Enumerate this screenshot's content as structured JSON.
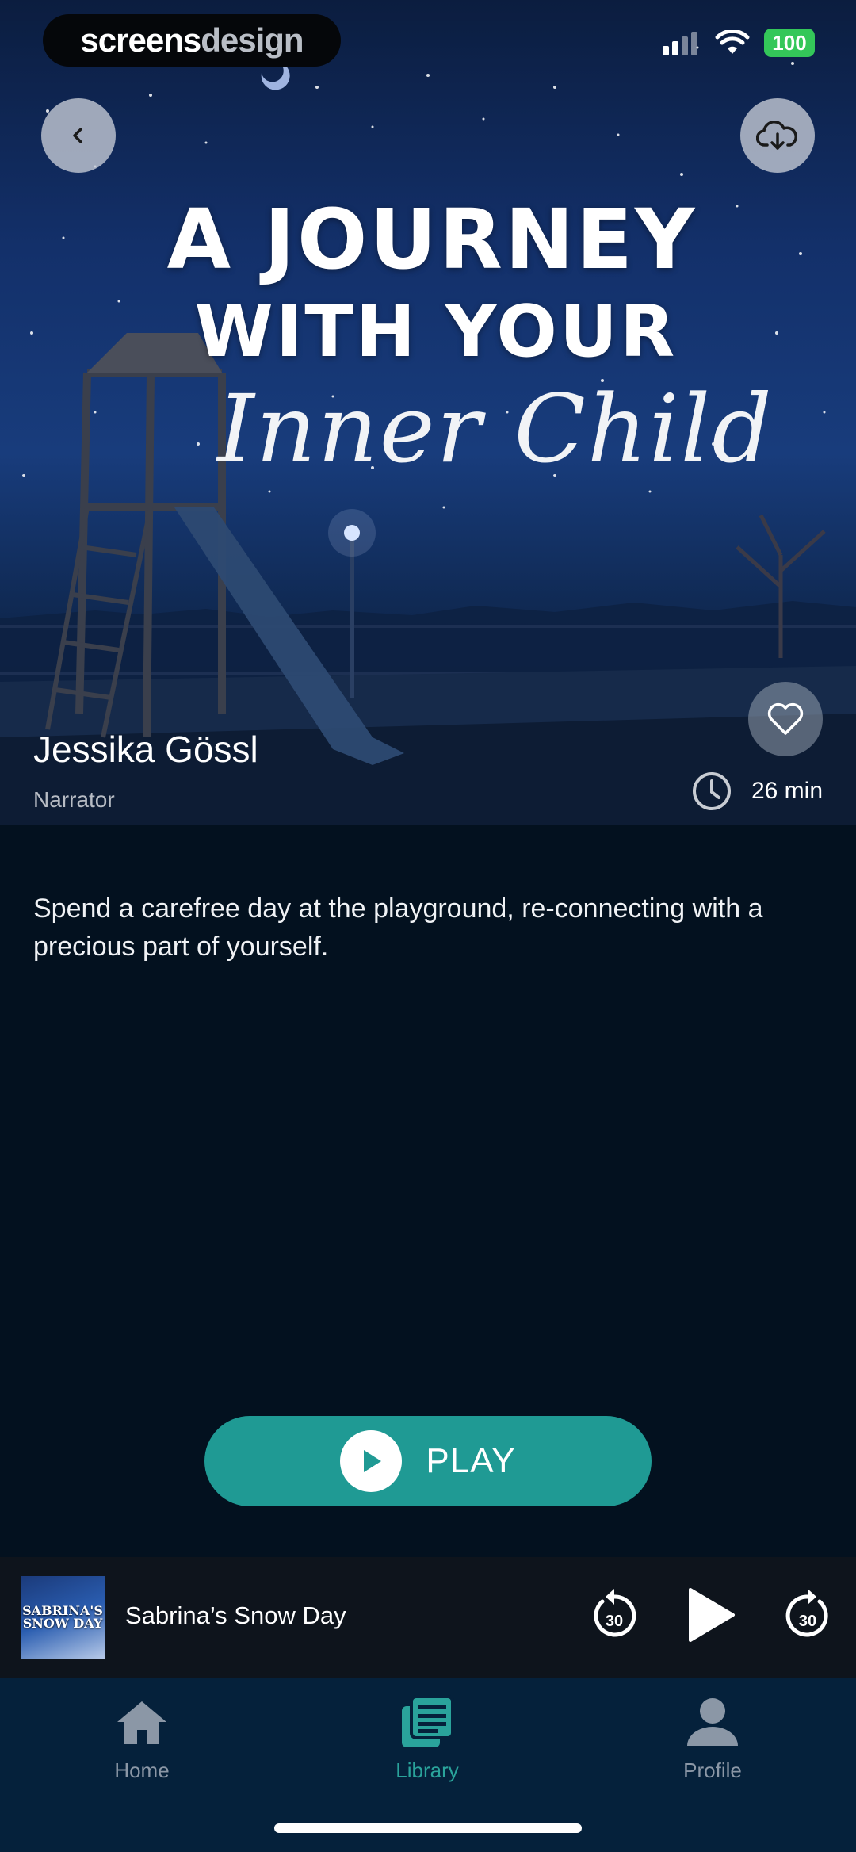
{
  "status_bar": {
    "brand_part1": "screens",
    "brand_part2": "design",
    "battery": "100"
  },
  "header": {
    "back_icon": "chevron-left-icon",
    "download_icon": "cloud-download-icon"
  },
  "cover": {
    "title_line1": "A JOURNEY",
    "title_line2": "WITH YOUR",
    "title_line3": "Inner Child"
  },
  "narrator": {
    "name": "Jessika Gössl",
    "role": "Narrator"
  },
  "duration": {
    "icon": "clock-icon",
    "value": "26 min"
  },
  "favorite_icon": "heart-icon",
  "description": "Spend a carefree day at the playground, re-connecting with a precious part of yourself.",
  "play_button": {
    "label": "PLAY"
  },
  "mini_player": {
    "cover_text": "SABRINA'S SNOW DAY",
    "title": "Sabrina’s Snow Day",
    "rewind_seconds": "30",
    "forward_seconds": "30"
  },
  "tabs": [
    {
      "label": "Home",
      "icon": "home-icon",
      "active": false
    },
    {
      "label": "Library",
      "icon": "library-icon",
      "active": true
    },
    {
      "label": "Profile",
      "icon": "profile-icon",
      "active": false
    }
  ],
  "colors": {
    "accent": "#1f9a94",
    "active_tab": "#2aa39b",
    "background": "#03111f",
    "tabbar": "#05213b"
  }
}
